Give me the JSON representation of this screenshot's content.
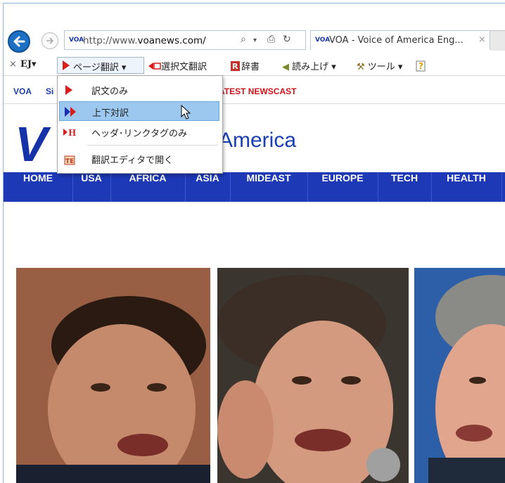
{
  "browser": {
    "url_domain_prefix": "http://www.",
    "url_domain": "voanews.com/",
    "favicon_text": "VOA",
    "tab_title": "VOA - Voice of America Eng...",
    "tab_close": "×"
  },
  "toolbar": {
    "close": "×",
    "ej_label": "EJ▾",
    "page_translate": "ページ翻訳 ▾",
    "selection_translate": "選択文翻訳",
    "dictionary": "辞書",
    "read_aloud": "読み上げ ▾",
    "tools": "ツール ▾"
  },
  "menu": {
    "items": [
      {
        "label": "訳文のみ",
        "icon": "single-arrow-icon"
      },
      {
        "label": "上下対訳",
        "icon": "double-arrow-icon",
        "highlighted": true
      },
      {
        "label": "ヘッダ･リンクタグのみ",
        "icon": "header-tag-icon"
      },
      {
        "label": "翻訳エディタで開く",
        "icon": "editor-icon"
      }
    ]
  },
  "site": {
    "top_voa": "VOA",
    "top_si": "Si",
    "latest_newscast": "ATEST NEWSCAST",
    "logo_letter": "V",
    "logo_text": "America",
    "nav": [
      "HOME",
      "USA",
      "AFRICA",
      "ASIA",
      "MIDEAST",
      "EUROPE",
      "TECH",
      "HEALTH"
    ]
  },
  "colors": {
    "nav_bg": "#1d39b6",
    "brand_blue": "#1632a8",
    "newscast_red": "#d0121b",
    "menu_highlight": "#9cc8f0"
  }
}
